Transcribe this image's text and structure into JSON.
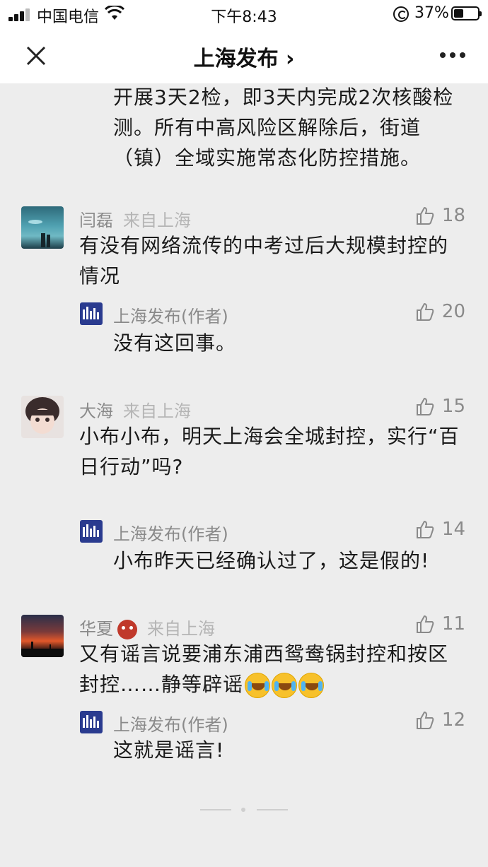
{
  "status_bar": {
    "carrier": "中国电信",
    "time": "下午8:43",
    "battery": "37%"
  },
  "nav": {
    "title": "上海发布 ›"
  },
  "top_reply": {
    "text": "开展3天2检，即3天内完成2次核酸检测。所有中高风险区解除后，街道（镇）全域实施常态化防控措施。"
  },
  "comments": [
    {
      "name": "闫磊",
      "origin": "来自上海",
      "likes": "18",
      "text": "有没有网络流传的中考过后大规模封控的情况",
      "reply": {
        "name": "上海发布(作者)",
        "likes": "20",
        "text": "没有这回事。"
      }
    },
    {
      "name": "大海",
      "origin": "来自上海",
      "likes": "15",
      "text": "小布小布，明天上海会全城封控，实行“百日行动”吗?",
      "reply": {
        "name": "上海发布(作者)",
        "likes": "14",
        "text": "小布昨天已经确认过了，这是假的!"
      }
    },
    {
      "name": "华夏",
      "origin": "来自上海",
      "likes": "11",
      "text": "又有谣言说要浦东浦西鸳鸯锅封控和按区封控……静等辟谣",
      "reply": {
        "name": "上海发布(作者)",
        "likes": "12",
        "text": "这就是谣言!"
      }
    }
  ]
}
